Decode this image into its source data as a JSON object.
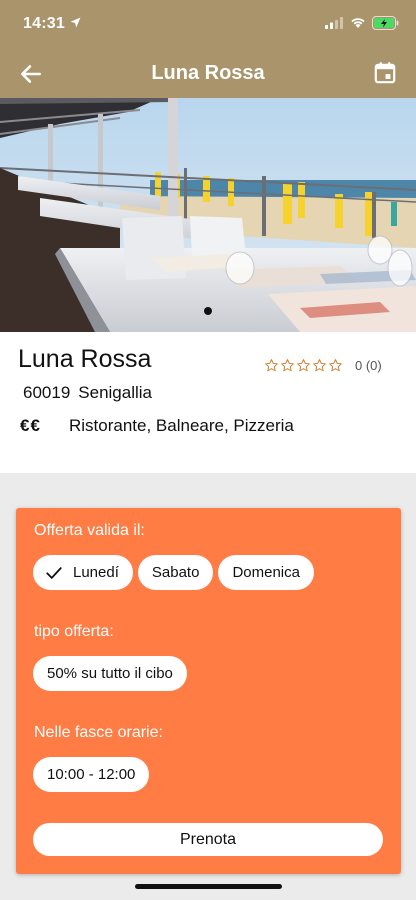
{
  "status_bar": {
    "time": "14:31",
    "icons": [
      "location-arrow-icon",
      "signal-icon",
      "wifi-icon",
      "battery-charging-icon"
    ],
    "battery_color": "#4cd964"
  },
  "nav": {
    "title": "Luna Rossa",
    "back_icon": "arrow-left-icon",
    "calendar_icon": "calendar-icon",
    "background": "#a9946b"
  },
  "gallery": {
    "page_count": 1,
    "active_page": 1
  },
  "restaurant": {
    "name": "Luna Rossa",
    "rating_stars": 0,
    "rating_label": "0 (0)",
    "postcode": "60019",
    "city": "Senigallia",
    "price_level": "€€",
    "categories": "Ristorante, Balneare, Pizzeria"
  },
  "offer": {
    "background": "#ff7c44",
    "days_label": "Offerta valida il:",
    "days": [
      {
        "label": "Lunedí",
        "selected": true
      },
      {
        "label": "Sabato",
        "selected": false
      },
      {
        "label": "Domenica",
        "selected": false
      }
    ],
    "type_label": "tipo offerta:",
    "type_value": "50% su tutto il cibo",
    "hours_label": "Nelle fasce orarie:",
    "hours_value": "10:00 - 12:00",
    "book_button": "Prenota"
  }
}
